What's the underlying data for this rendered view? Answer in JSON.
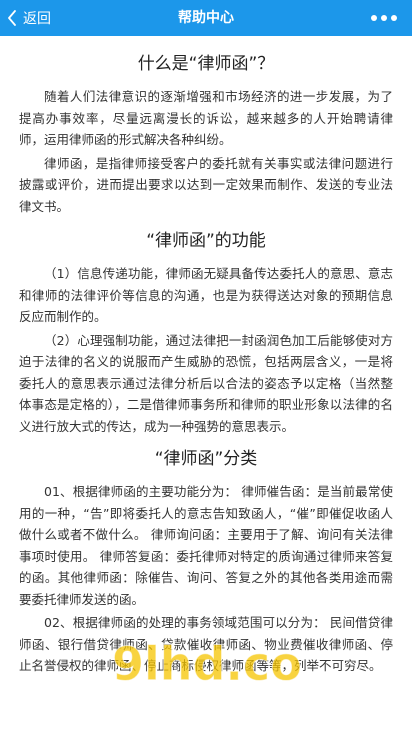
{
  "header": {
    "back_label": "返回",
    "title": "帮助中心",
    "bg_color": "#1c97ea"
  },
  "article": {
    "sections": [
      {
        "heading": "什么是“律师函”？",
        "paragraphs": [
          "随着人们法律意识的逐渐增强和市场经济的进一步发展，为了提高办事效率，尽量远离漫长的诉讼，越来越多的人开始聘请律师，运用律师函的形式解决各种纠纷。",
          "律师函，是指律师接受客户的委托就有关事实或法律问题进行披露或评价，进而提出要求以达到一定效果而制作、发送的专业法律文书。"
        ]
      },
      {
        "heading": "“律师函”的功能",
        "paragraphs": [
          "（1）信息传递功能，律师函无疑具备传达委托人的意思、意志和律师的法律评价等信息的沟通，也是为获得送达对象的预期信息反应而制作的。",
          "（2）心理强制功能，通过法律把一封函润色加工后能够使对方迫于法律的名义的说服而产生威胁的恐慌，包括两层含义，一是将委托人的意思表示通过法律分析后以合法的姿态予以定格（当然整体事态是定格的），二是借律师事务所和律师的职业形象以法律的名义进行放大式的传达，成为一种强势的意思表示。"
        ]
      },
      {
        "heading": "“律师函”分类",
        "paragraphs": [
          "01、根据律师函的主要功能分为： 律师催告函：是当前最常使用的一种，“告”即将委托人的意志告知致函人，“催”即催促收函人做什么或者不做什么。 律师询问函：主要用于了解、询问有关法律事项时使用。 律师答复函：委托律师对特定的质询通过律师来答复的函。其他律师函：除催告、询问、答复之外的其他各类用途而需要委托律师发送的函。",
          "02、根据律师函的处理的事务领域范围可以分为： 民间借贷律师函、银行借贷律师函、贷款催收律师函、物业费催收律师函、停止名誉侵权的律师函、停止商标侵权律师函等等，列举不可穷尽。"
        ]
      }
    ]
  },
  "watermark": {
    "text": "9lhd.com",
    "color": "#f5c400"
  }
}
